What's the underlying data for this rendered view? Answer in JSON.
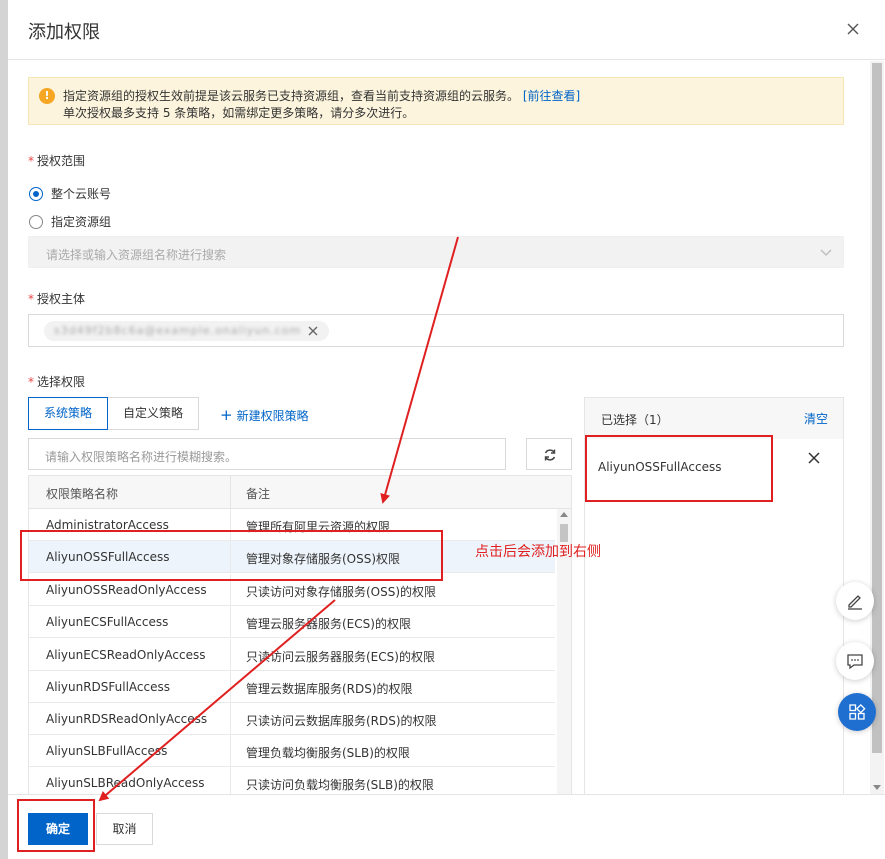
{
  "dialog": {
    "title": "添加权限"
  },
  "alert": {
    "line1": "指定资源组的授权生效前提是该云服务已支持资源组，查看当前支持资源组的云服务。",
    "link": "[前往查看]",
    "line2": "单次授权最多支持 5 条策略，如需绑定更多策略，请分多次进行。"
  },
  "scope": {
    "required_mark": "*",
    "label": "授权范围",
    "options": [
      "整个云账号",
      "指定资源组"
    ],
    "selected": "整个云账号",
    "resource_group_placeholder": "请选择或输入资源组名称进行搜索"
  },
  "principal": {
    "required_mark": "*",
    "label": "授权主体",
    "tag_text": "s3d49f2b8c6a@example.onaliyun.com"
  },
  "permissions": {
    "required_mark": "*",
    "label": "选择权限",
    "tabs": [
      "系统策略",
      "自定义策略"
    ],
    "active_tab": "系统策略",
    "new_policy_label": "新建权限策略",
    "search_placeholder": "请输入权限策略名称进行模糊搜索。",
    "columns": [
      "权限策略名称",
      "备注"
    ],
    "rows": [
      {
        "name": "AdministratorAccess",
        "note": "管理所有阿里云资源的权限"
      },
      {
        "name": "AliyunOSSFullAccess",
        "note": "管理对象存储服务(OSS)权限"
      },
      {
        "name": "AliyunOSSReadOnlyAccess",
        "note": "只读访问对象存储服务(OSS)的权限"
      },
      {
        "name": "AliyunECSFullAccess",
        "note": "管理云服务器服务(ECS)的权限"
      },
      {
        "name": "AliyunECSReadOnlyAccess",
        "note": "只读访问云服务器服务(ECS)的权限"
      },
      {
        "name": "AliyunRDSFullAccess",
        "note": "管理云数据库服务(RDS)的权限"
      },
      {
        "name": "AliyunRDSReadOnlyAccess",
        "note": "只读访问云数据库服务(RDS)的权限"
      },
      {
        "name": "AliyunSLBFullAccess",
        "note": "管理负载均衡服务(SLB)的权限"
      },
      {
        "name": "AliyunSLBReadOnlyAccess",
        "note": "只读访问负载均衡服务(SLB)的权限"
      }
    ],
    "selected_row": "AliyunOSSFullAccess"
  },
  "selected_panel": {
    "title": "已选择（1）",
    "clear_label": "清空",
    "items": [
      "AliyunOSSFullAccess"
    ]
  },
  "annotation": {
    "text": "点击后会添加到右侧"
  },
  "footer": {
    "ok_label": "确定",
    "cancel_label": "取消"
  },
  "colors": {
    "primary": "#0064c8",
    "annotation_red": "#e02020",
    "alert_bg": "#fcf4dc"
  },
  "icons": [
    "close-icon",
    "warning-icon",
    "chevron-down-icon",
    "refresh-icon",
    "plus-icon",
    "edit-icon",
    "chat-icon",
    "apps-icon"
  ]
}
